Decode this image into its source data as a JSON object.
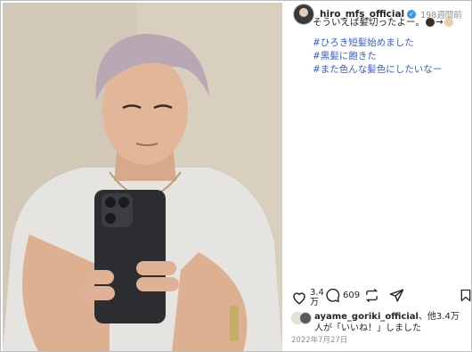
{
  "post": {
    "username": "hiro_mfs_official",
    "time_ago": "198週間前",
    "caption": "そういえば髪切ったよー。",
    "caption_arrow": "→",
    "hashtags": [
      "#ひろき短髪始めました",
      "#黒髪に飽きた",
      "#また色んな髪色にしたいなー"
    ],
    "likes_count": "3.4\n万",
    "comments_count": "609",
    "liked_by_user": "ayame_goriki_official",
    "liked_by_suffix": "、他3.4万人が「いいね！」しました",
    "date": "2022年7月27日"
  },
  "icons": [
    "heart-icon",
    "comment-icon",
    "repost-icon",
    "share-icon",
    "bookmark-icon",
    "verified-icon"
  ],
  "colors": {
    "hashtag": "#3b5bdb",
    "verified": "#3897f0",
    "muted": "#8e8e8e"
  }
}
